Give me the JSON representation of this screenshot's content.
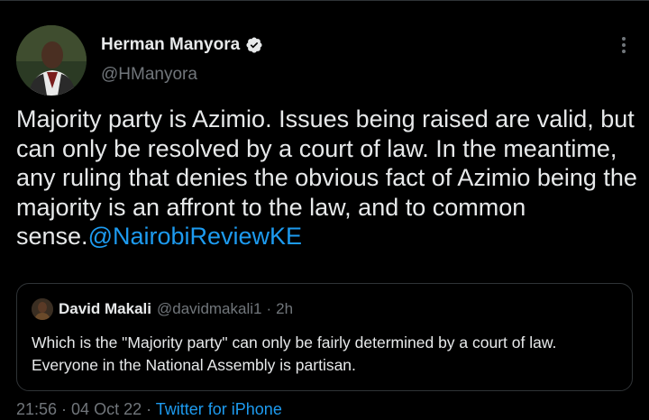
{
  "tweet": {
    "author": {
      "display_name": "Herman Manyora",
      "handle": "@HManyora",
      "verified": true,
      "avatar_icon": "profile-photo"
    },
    "text": "Majority party is Azimio. Issues being raised are valid, but can only be resolved by a court of law. In the meantime, any ruling that denies the obvious fact of Azimio being the majority is an affront to the law, and to common sense.",
    "mention": "@NairobiReviewKE",
    "more_icon": "more-horizontal-icon",
    "quoted": {
      "display_name": "David Makali",
      "handle": "@davidmakali1",
      "separator": "·",
      "time": "2h",
      "text": "Which is the \"Majority party\" can only be fairly determined by a court of law. Everyone in the National Assembly is partisan."
    },
    "meta": {
      "time": "21:56",
      "separator1": " · ",
      "date": "04 Oct 22",
      "separator2": " · ",
      "source": "Twitter for iPhone"
    }
  },
  "colors": {
    "background": "#000000",
    "text": "#e7e9ea",
    "secondary": "#71767b",
    "accent": "#1d9bf0",
    "border": "#2f3336"
  }
}
